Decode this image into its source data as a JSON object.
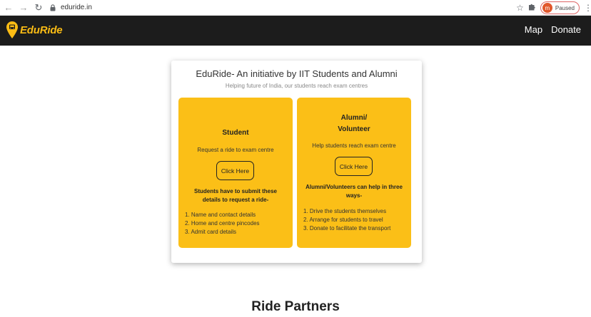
{
  "browser": {
    "back_icon": "arrow-left-icon",
    "forward_icon": "arrow-right-icon",
    "reload_icon": "reload-icon",
    "url": "eduride.in",
    "avatar_letter": "m",
    "profile_status": "Paused"
  },
  "header": {
    "logo_text": "EduRide",
    "nav": [
      "Map",
      "Donate"
    ]
  },
  "card": {
    "title": "EduRide- An initiative by IIT Students and Alumni",
    "subtitle": "Helping future of India, our students reach exam centres",
    "student": {
      "heading": "Student",
      "description": "Request a ride to exam centre",
      "button": "Click Here",
      "note": "Students have to submit these details to request a ride-",
      "items": [
        "Name and contact details",
        "Home and centre pincodes",
        "Admit card details"
      ]
    },
    "volunteer": {
      "heading_line1": "Alumni/",
      "heading_line2": "Volunteer",
      "description": "Help students reach exam centre",
      "button": "Click Here",
      "note": "Alumni/Volunteers can help in three ways-",
      "items": [
        "Drive the students themselves",
        "Arrange for students to travel",
        "Donate to facilitate the transport"
      ]
    }
  },
  "partners": {
    "heading": "Ride Partners"
  },
  "colors": {
    "brand_yellow": "#fbbf17",
    "header_bg": "#1c1c1c"
  }
}
